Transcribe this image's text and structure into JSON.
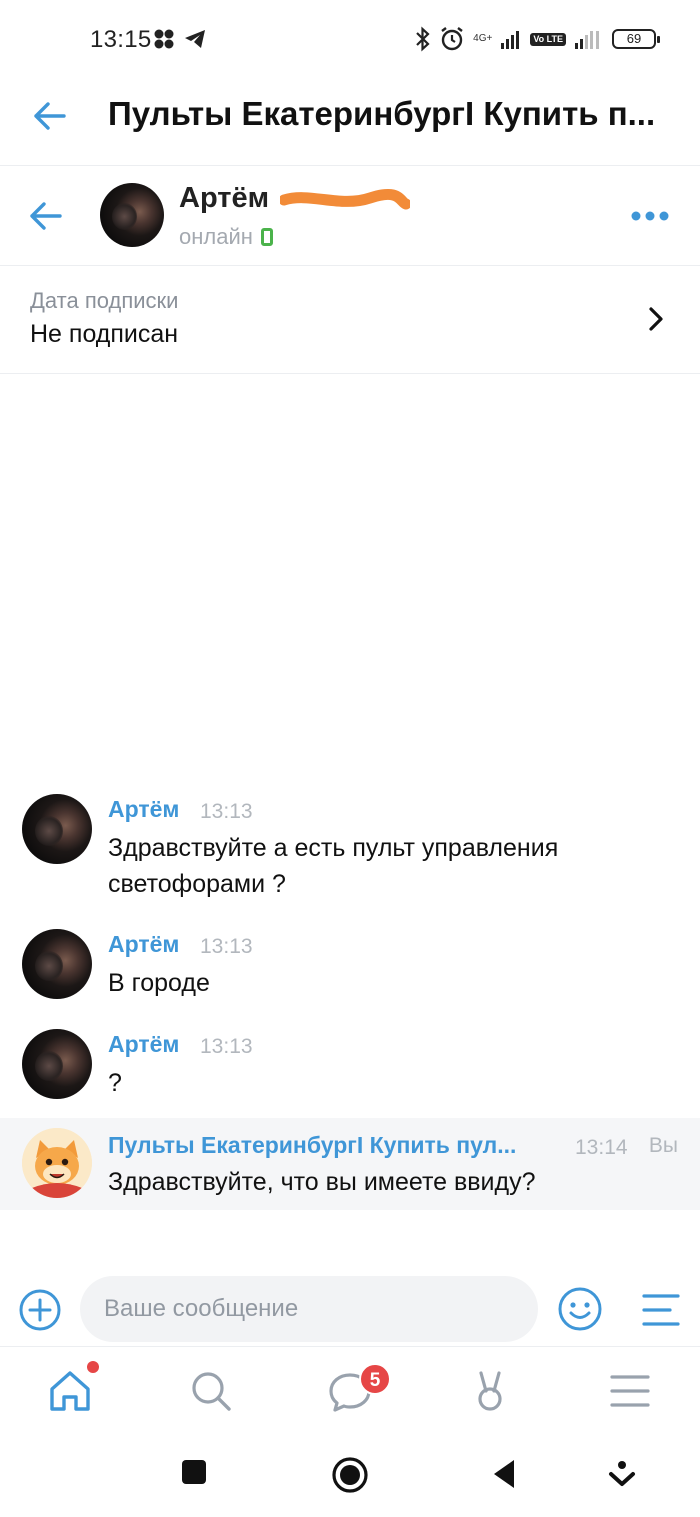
{
  "status_bar": {
    "time": "13:15",
    "network_label": "4G+",
    "volte_label": "Vo LTE",
    "battery": "69"
  },
  "header": {
    "title": "Пульты ЕкатеринбургI Купить п..."
  },
  "chat_header": {
    "contact_name": "Артём",
    "status": "онлайн"
  },
  "subscription": {
    "label": "Дата подписки",
    "value": "Не подписан"
  },
  "messages": [
    {
      "author": "Артём",
      "time": "13:13",
      "text": "Здравствуйте а есть пульт управления светофорами ?"
    },
    {
      "author": "Артём",
      "time": "13:13",
      "text": "В городе"
    },
    {
      "author": "Артём",
      "time": "13:13",
      "text": "?"
    },
    {
      "author": "Пульты ЕкатеринбургI Купить пул...",
      "time": "13:14",
      "sender_tag": "Вы",
      "text": "Здравствуйте, что вы имеете ввиду?"
    }
  ],
  "composer": {
    "placeholder": "Ваше сообщение"
  },
  "bottom_nav": {
    "messages_badge": "5"
  },
  "colors": {
    "accent": "#3f96d7",
    "online_green": "#4bb34b",
    "badge_red": "#e64646",
    "muted_text": "#a4a9b0"
  }
}
